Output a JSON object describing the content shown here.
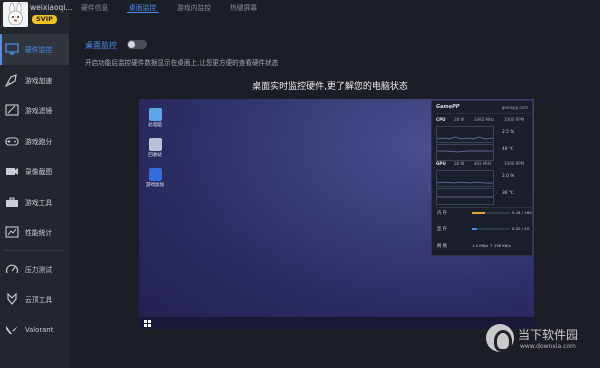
{
  "profile": {
    "username": "weixiaoqi...",
    "badge": "SVIP"
  },
  "sidebar": {
    "items": [
      {
        "label": "硬件监控",
        "icon": "monitor-icon"
      },
      {
        "label": "游戏加速",
        "icon": "rocket-icon"
      },
      {
        "label": "游戏滤镜",
        "icon": "filter-icon"
      },
      {
        "label": "游戏跑分",
        "icon": "gamepad-icon"
      },
      {
        "label": "录像截图",
        "icon": "camera-icon"
      },
      {
        "label": "游戏工具",
        "icon": "toolbox-icon"
      },
      {
        "label": "性能统计",
        "icon": "chart-icon"
      },
      {
        "label": "压力测试",
        "icon": "speedometer-icon"
      },
      {
        "label": "云顶工具",
        "icon": "chess-icon"
      },
      {
        "label": "Valorant",
        "icon": "valorant-icon"
      }
    ]
  },
  "tabs": [
    "硬件信息",
    "桌面监控",
    "游戏内监控",
    "热键屏幕"
  ],
  "main": {
    "section_title": "桌面监控",
    "toggle_on": false,
    "description": "开启功能后监控硬件数据显示在桌面上,让您更方便的查看硬件状态",
    "preview_heading": "桌面实时监控硬件,更了解您的电脑状态"
  },
  "preview": {
    "desktop_icons": [
      "此电脑",
      "回收站",
      "游戏加加"
    ],
    "overlay": {
      "logo": "GamePP",
      "url": "gamepp.com",
      "cpu": {
        "tag": "CPU",
        "power": "28 W",
        "clock": "3492 MHz",
        "fan": "1000 RPM",
        "usage": "2.5 %",
        "temp": "49 ℃"
      },
      "gpu": {
        "tag": "GPU",
        "power": "28 W",
        "clock": "492 MHz",
        "fan": "1000 RPM",
        "usage": "2.0 %",
        "temp": "36 ℃"
      },
      "ram": {
        "tag": "内 存",
        "value": "5.46 / 16G",
        "fill": 0.34
      },
      "vram": {
        "tag": "显 存",
        "value": "0.50 / 4G",
        "fill": 0.12
      },
      "net": {
        "tag": "网 络",
        "value": "1.0 MB/s  ↑ 258 KB/s"
      }
    }
  },
  "watermark": {
    "title": "当下软件园",
    "url": "www.downxia.com"
  },
  "colors": {
    "accent": "#4c90f2",
    "svip": "#f3c21b",
    "sidebar_bg": "#23262d",
    "main_bg": "#1b1e24"
  }
}
